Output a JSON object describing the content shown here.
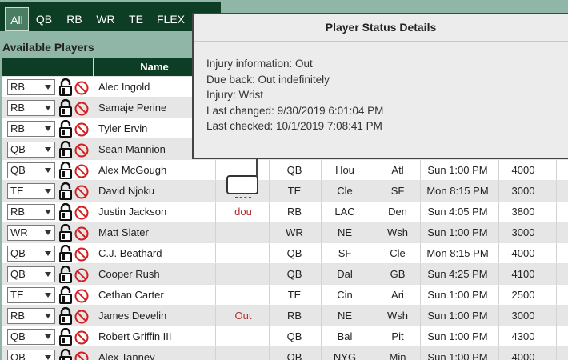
{
  "tabs": [
    "All",
    "QB",
    "RB",
    "WR",
    "TE",
    "FLEX"
  ],
  "section_title": "Available Players",
  "table": {
    "name_header": "Name",
    "rows": [
      {
        "pos_select": "RB",
        "name": "Alec Ingold",
        "status": "",
        "pos": "",
        "team": "",
        "opp": "",
        "time": "",
        "salary": ""
      },
      {
        "pos_select": "RB",
        "name": "Samaje Perine",
        "status": "",
        "pos": "",
        "team": "",
        "opp": "",
        "time": "",
        "salary": ""
      },
      {
        "pos_select": "RB",
        "name": "Tyler Ervin",
        "status": "",
        "pos": "",
        "team": "",
        "opp": "",
        "time": "",
        "salary": ""
      },
      {
        "pos_select": "QB",
        "name": "Sean Mannion",
        "status": "",
        "pos": "",
        "team": "",
        "opp": "",
        "time": "",
        "salary": ""
      },
      {
        "pos_select": "QB",
        "name": "Alex McGough",
        "status": "",
        "pos": "QB",
        "team": "Hou",
        "opp": "Atl",
        "time": "Sun 1:00 PM",
        "salary": "4000"
      },
      {
        "pos_select": "TE",
        "name": "David Njoku",
        "status": "Out",
        "pos": "TE",
        "team": "Cle",
        "opp": "SF",
        "time": "Mon 8:15 PM",
        "salary": "3000"
      },
      {
        "pos_select": "RB",
        "name": "Justin Jackson",
        "status": "dou",
        "pos": "RB",
        "team": "LAC",
        "opp": "Den",
        "time": "Sun 4:05 PM",
        "salary": "3800"
      },
      {
        "pos_select": "WR",
        "name": "Matt Slater",
        "status": "",
        "pos": "WR",
        "team": "NE",
        "opp": "Wsh",
        "time": "Sun 1:00 PM",
        "salary": "3000"
      },
      {
        "pos_select": "QB",
        "name": "C.J. Beathard",
        "status": "",
        "pos": "QB",
        "team": "SF",
        "opp": "Cle",
        "time": "Mon 8:15 PM",
        "salary": "4000"
      },
      {
        "pos_select": "QB",
        "name": "Cooper Rush",
        "status": "",
        "pos": "QB",
        "team": "Dal",
        "opp": "GB",
        "time": "Sun 4:25 PM",
        "salary": "4100"
      },
      {
        "pos_select": "TE",
        "name": "Cethan Carter",
        "status": "",
        "pos": "TE",
        "team": "Cin",
        "opp": "Ari",
        "time": "Sun 1:00 PM",
        "salary": "2500"
      },
      {
        "pos_select": "RB",
        "name": "James Develin",
        "status": "Out",
        "pos": "RB",
        "team": "NE",
        "opp": "Wsh",
        "time": "Sun 1:00 PM",
        "salary": "3000"
      },
      {
        "pos_select": "QB",
        "name": "Robert Griffin III",
        "status": "",
        "pos": "QB",
        "team": "Bal",
        "opp": "Pit",
        "time": "Sun 1:00 PM",
        "salary": "4300"
      },
      {
        "pos_select": "QB",
        "name": "Alex Tanney",
        "status": "",
        "pos": "QB",
        "team": "NYG",
        "opp": "Min",
        "time": "Sun 1:00 PM",
        "salary": "4000"
      }
    ]
  },
  "tooltip": {
    "title": "Player Status Details",
    "lines": [
      "Injury information: Out",
      "Due back: Out indefinitely",
      "Injury: Wrist",
      "Last changed: 9/30/2019 6:01:04 PM",
      "Last checked: 10/1/2019 7:08:41 PM"
    ]
  },
  "colors": {
    "header_bg": "#0d3d24",
    "active_tab": "#4a7e63",
    "status_red": "#b03030"
  },
  "icons": [
    "chevron-down-icon",
    "lock-icon",
    "ban-icon"
  ]
}
